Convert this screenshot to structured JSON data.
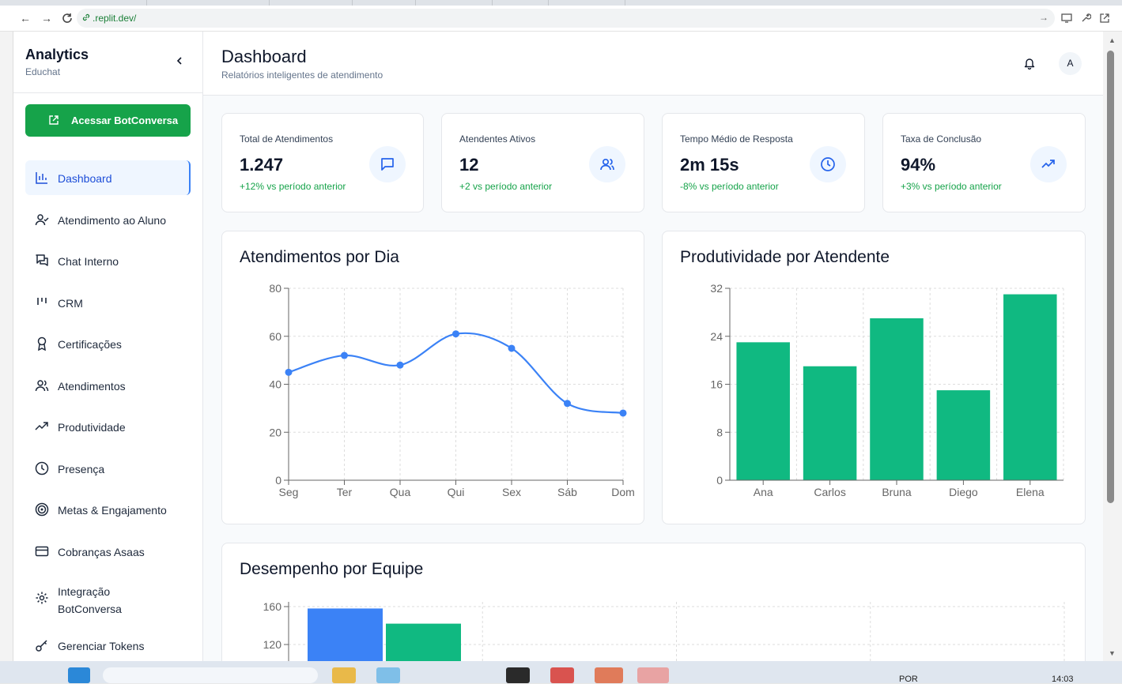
{
  "browser": {
    "url": ".replit.dev/",
    "nav_back": "←",
    "nav_forward": "→",
    "go": "→"
  },
  "sidebar": {
    "title": "Analytics",
    "subtitle": "Educhat",
    "cta_label": "Acessar BotConversa",
    "items": [
      {
        "label": "Dashboard",
        "icon": "bar-chart-icon",
        "active": true
      },
      {
        "label": "Atendimento ao Aluno",
        "icon": "user-check-icon"
      },
      {
        "label": "Chat Interno",
        "icon": "messages-icon"
      },
      {
        "label": "CRM",
        "icon": "kanban-icon"
      },
      {
        "label": "Certificações",
        "icon": "award-icon"
      },
      {
        "label": "Atendimentos",
        "icon": "users-icon"
      },
      {
        "label": "Produtividade",
        "icon": "trending-up-icon"
      },
      {
        "label": "Presença",
        "icon": "clock-icon"
      },
      {
        "label": "Metas & Engajamento",
        "icon": "target-icon"
      },
      {
        "label": "Cobranças Asaas",
        "icon": "credit-card-icon"
      },
      {
        "label": "Integração BotConversa",
        "icon": "settings-icon"
      },
      {
        "label": "Gerenciar Tokens",
        "icon": "key-icon"
      }
    ]
  },
  "header": {
    "title": "Dashboard",
    "subtitle": "Relatórios inteligentes de atendimento",
    "avatar": "A"
  },
  "stats": [
    {
      "label": "Total de Atendimentos",
      "value": "1.247",
      "delta": "+12% vs período anterior",
      "icon": "message-square-icon"
    },
    {
      "label": "Atendentes Ativos",
      "value": "12",
      "delta": "+2 vs período anterior",
      "icon": "users-icon"
    },
    {
      "label": "Tempo Médio de Resposta",
      "value": "2m 15s",
      "delta": "-8% vs período anterior",
      "icon": "clock-icon"
    },
    {
      "label": "Taxa de Conclusão",
      "value": "94%",
      "delta": "+3% vs período anterior",
      "icon": "trending-up-icon"
    }
  ],
  "colors": {
    "accent": "#3b82f6",
    "green": "#10b981",
    "brand_button": "#16a34a",
    "delta_text": "#16a34a"
  },
  "chart_data": [
    {
      "type": "line",
      "title": "Atendimentos por Dia",
      "categories": [
        "Seg",
        "Ter",
        "Qua",
        "Qui",
        "Sex",
        "Sáb",
        "Dom"
      ],
      "values": [
        45,
        52,
        48,
        61,
        55,
        32,
        28
      ],
      "ylim": [
        0,
        80
      ],
      "yticks": [
        0,
        20,
        40,
        60,
        80
      ],
      "grid": true,
      "color": "#3b82f6"
    },
    {
      "type": "bar",
      "title": "Produtividade por Atendente",
      "categories": [
        "Ana",
        "Carlos",
        "Bruna",
        "Diego",
        "Elena"
      ],
      "values": [
        23,
        19,
        27,
        15,
        31
      ],
      "ylim": [
        0,
        32
      ],
      "yticks": [
        0,
        8,
        16,
        24,
        32
      ],
      "grid": true,
      "color": "#10b981"
    },
    {
      "type": "bar",
      "title": "Desempenho por Equipe",
      "yticks_visible": [
        120,
        160
      ],
      "series": [
        {
          "values": [
            158
          ],
          "color": "#3b82f6"
        },
        {
          "values": [
            142
          ],
          "color": "#10b981"
        }
      ],
      "grid": true
    }
  ],
  "taskbar": {
    "lang": "POR",
    "time": "14:03"
  }
}
